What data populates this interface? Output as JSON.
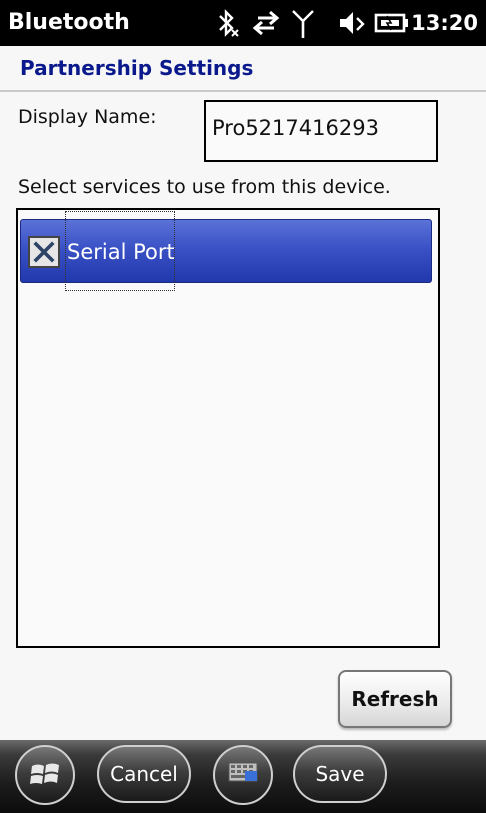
{
  "statusbar": {
    "title": "Bluetooth",
    "time": "13:20",
    "icons": [
      "bluetooth-off-icon",
      "data-transfer-icon",
      "signal-icon",
      "volume-icon",
      "battery-icon"
    ]
  },
  "header": {
    "title": "Partnership Settings"
  },
  "form": {
    "display_name_label": "Display Name:",
    "display_name_value": "Pro5217416293",
    "services_label": "Select services to use from this device.",
    "services": [
      {
        "label": "Serial Port",
        "checked": true
      }
    ],
    "refresh_label": "Refresh"
  },
  "bottombar": {
    "start_icon": "windows-start-icon",
    "cancel_label": "Cancel",
    "keyboard_icon": "keyboard-icon",
    "save_label": "Save"
  },
  "colors": {
    "title_blue": "#0a1a8c",
    "selection_blue": "#3a52c5"
  }
}
